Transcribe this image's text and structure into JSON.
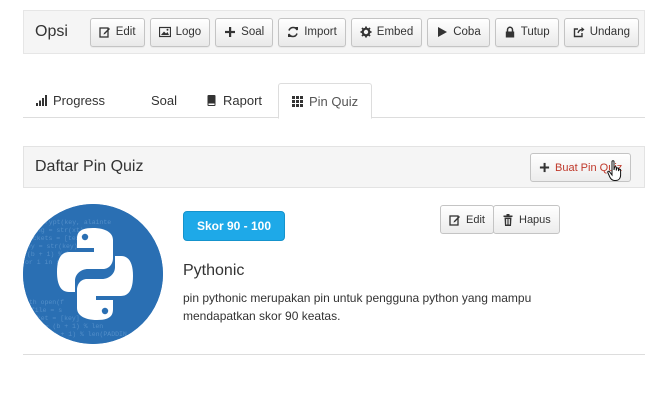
{
  "topbar": {
    "title": "Opsi",
    "buttons": [
      {
        "label": "Edit",
        "icon": "edit-icon"
      },
      {
        "label": "Logo",
        "icon": "image-icon"
      },
      {
        "label": "Soal",
        "icon": "plus-icon"
      },
      {
        "label": "Import",
        "icon": "refresh-icon"
      },
      {
        "label": "Embed",
        "icon": "gear-icon"
      },
      {
        "label": "Coba",
        "icon": "play-icon"
      },
      {
        "label": "Tutup",
        "icon": "lock-icon"
      },
      {
        "label": "Undang",
        "icon": "share-icon"
      }
    ]
  },
  "tabs": [
    {
      "label": "Progress",
      "icon": "bar-chart-icon",
      "active": false
    },
    {
      "label": "Soal",
      "icon": "",
      "active": false
    },
    {
      "label": "Raport",
      "icon": "book-icon",
      "active": false
    },
    {
      "label": "Pin Quiz",
      "icon": "grid-icon",
      "active": true
    }
  ],
  "panel": {
    "title": "Daftar Pin Quiz",
    "create_label": "Buat Pin Quiz"
  },
  "pin": {
    "badge": "Skor 90 - 100",
    "name": "Pythonic",
    "description": "pin pythonic merupakan pin untuk pengguna python yang mampu mendapatkan skor 90 keatas.",
    "edit_label": "Edit",
    "delete_label": "Hapus"
  },
  "colors": {
    "badge": "#1ea9e8",
    "accent_red": "#c0392b",
    "avatar_bg": "#2a6fb3"
  }
}
